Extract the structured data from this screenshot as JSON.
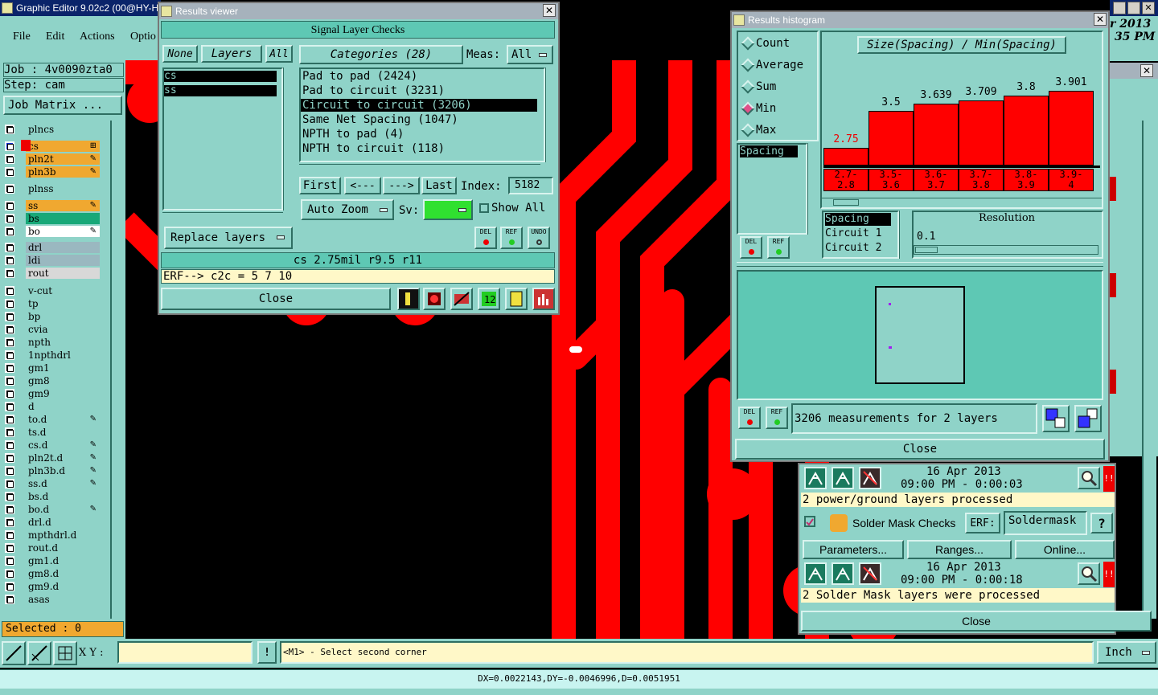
{
  "main_window": {
    "title": "Graphic Editor 9.02c2 (00@HY-H",
    "menus": [
      "File",
      "Edit",
      "Actions",
      "Optio"
    ]
  },
  "job_panel": {
    "job": "Job : 4v0090zta0",
    "step": "Step: cam",
    "job_matrix": "Job Matrix ...",
    "selected": "Selected : 0"
  },
  "layers": [
    {
      "name": "plncs",
      "color": "#8fd3c8"
    },
    {
      "name": "cs",
      "color": "#f0a830"
    },
    {
      "name": "pln2t",
      "color": "#f0a830"
    },
    {
      "name": "pln3b",
      "color": "#f0a830"
    },
    {
      "name": "plnss",
      "color": "#8fd3c8"
    },
    {
      "name": "ss",
      "color": "#f0a830"
    },
    {
      "name": "bs",
      "color": "#18a878"
    },
    {
      "name": "bo",
      "color": "#ffffff"
    },
    {
      "name": "drl",
      "color": "#9ab8c0"
    },
    {
      "name": "ldi",
      "color": "#9ab8c0"
    },
    {
      "name": "rout",
      "color": "#d8d8d8"
    },
    {
      "name": "v-cut",
      "color": "#8fd3c8"
    },
    {
      "name": "tp",
      "color": "#8fd3c8"
    },
    {
      "name": "bp",
      "color": "#8fd3c8"
    },
    {
      "name": "cvia",
      "color": "#8fd3c8"
    },
    {
      "name": "npth",
      "color": "#8fd3c8"
    },
    {
      "name": "1npthdrl",
      "color": "#8fd3c8"
    },
    {
      "name": "gm1",
      "color": "#8fd3c8"
    },
    {
      "name": "gm8",
      "color": "#8fd3c8"
    },
    {
      "name": "gm9",
      "color": "#8fd3c8"
    },
    {
      "name": "d",
      "color": "#8fd3c8"
    },
    {
      "name": "to.d",
      "color": "#8fd3c8"
    },
    {
      "name": "ts.d",
      "color": "#8fd3c8"
    },
    {
      "name": "cs.d",
      "color": "#8fd3c8"
    },
    {
      "name": "pln2t.d",
      "color": "#8fd3c8"
    },
    {
      "name": "pln3b.d",
      "color": "#8fd3c8"
    },
    {
      "name": "ss.d",
      "color": "#8fd3c8"
    },
    {
      "name": "bs.d",
      "color": "#8fd3c8"
    },
    {
      "name": "bo.d",
      "color": "#8fd3c8"
    },
    {
      "name": "drl.d",
      "color": "#8fd3c8"
    },
    {
      "name": "mpthdrl.d",
      "color": "#8fd3c8"
    },
    {
      "name": "rout.d",
      "color": "#8fd3c8"
    },
    {
      "name": "gm1.d",
      "color": "#8fd3c8"
    },
    {
      "name": "gm8.d",
      "color": "#8fd3c8"
    },
    {
      "name": "gm9.d",
      "color": "#8fd3c8"
    },
    {
      "name": "asas",
      "color": "#8fd3c8"
    }
  ],
  "results_viewer": {
    "title": "Results viewer",
    "header": "Signal Layer Checks",
    "none_btn": "None",
    "layers_btn": "Layers",
    "all_btn": "All",
    "layer_list": [
      "cs",
      "ss"
    ],
    "categories_btn": "Categories (28)",
    "meas_label": "Meas:",
    "meas_value": "All",
    "categories": [
      "Pad to pad (2424)",
      "Pad to circuit (3231)",
      "Circuit to circuit (3206)",
      "Same Net Spacing (1047)",
      "NPTH to pad (4)",
      "NPTH to circuit (118)"
    ],
    "first": "First",
    "prev": "<---",
    "next": "--->",
    "last": "Last",
    "index_label": "Index:",
    "index_value": "5182",
    "auto_zoom": "Auto Zoom",
    "sv_label": "Sv:",
    "show_all": "Show All",
    "replace_layers": "Replace layers",
    "del": "DEL",
    "ref": "REF",
    "undo": "UNDO",
    "status": "cs 2.75mil   r9.5   r11",
    "erf": "ERF--> c2c = 5 7 10",
    "close": "Close"
  },
  "histogram": {
    "title": "Results histogram",
    "options": [
      "Count",
      "Average",
      "Sum",
      "Min",
      "Max"
    ],
    "selected_option": "Min",
    "chart_title": "Size(Spacing) / Min(Spacing)",
    "list_label": "Spacing",
    "spacing_list": [
      "Spacing",
      "Circuit 1",
      "Circuit 2"
    ],
    "resolution_label": "Resolution",
    "resolution_value": "0.1",
    "measurements": "3206 measurements for 2 layers",
    "del": "DEL",
    "ref": "REF",
    "close": "Close",
    "range_labels": [
      "2.7-\n2.8",
      "3.5-\n3.6",
      "3.6-\n3.7",
      "3.7-\n3.8",
      "3.8-\n3.9",
      "3.9-\n4"
    ]
  },
  "chart_data": {
    "type": "bar",
    "title": "Size(Spacing) / Min(Spacing)",
    "categories": [
      "2.7-2.8",
      "3.5-3.6",
      "3.6-3.7",
      "3.7-3.8",
      "3.8-3.9",
      "3.9-4"
    ],
    "values": [
      2.75,
      3.5,
      3.639,
      3.709,
      3.8,
      3.901
    ],
    "value_labels": [
      "2.75",
      "3.5",
      "3.639",
      "3.709",
      "3.8",
      "3.901"
    ],
    "ylim": [
      2.4,
      3.95
    ]
  },
  "checks_panel": {
    "entry1": {
      "date": "16 Apr 2013",
      "time": "09:00 PM - 0:00:03",
      "message": "2 power/ground layers processed"
    },
    "solder": {
      "name": "Solder Mask Checks",
      "erf_label": "ERF:",
      "erf_value": "Soldermask",
      "help": "?"
    },
    "parameters": "Parameters...",
    "ranges": "Ranges...",
    "online": "Online...",
    "entry2": {
      "date": "16 Apr 2013",
      "time": "09:00 PM - 0:00:18",
      "message": "2 Solder Mask layers were processed"
    },
    "close": "Close",
    "warn": "!!"
  },
  "topright": {
    "line1": "r 2013",
    "line2": "35 PM"
  },
  "bottom": {
    "xy_label": "X Y :",
    "xy_value": "",
    "alert": "!",
    "prompt": "<M1> - Select second corner",
    "units": "Inch",
    "readout": "DX=0.0022143,DY=-0.0046996,D=0.0051951"
  },
  "colors": {
    "panel": "#8fd3c8",
    "accent_teal": "#5ec8b4",
    "trace_red": "#ff0000",
    "highlight": "#f0a830"
  }
}
